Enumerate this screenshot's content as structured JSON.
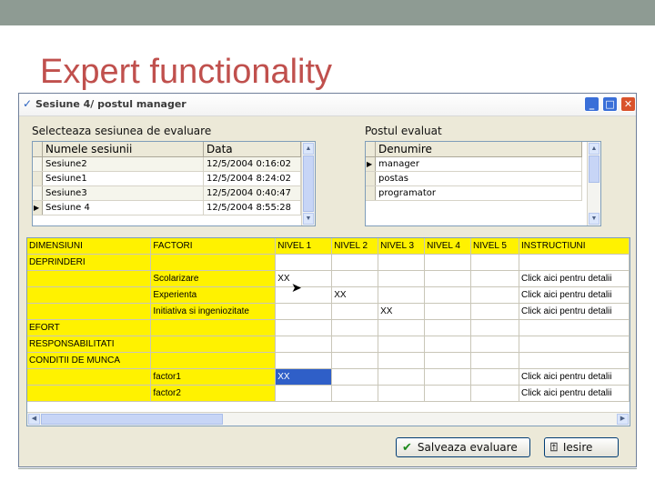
{
  "slide": {
    "title": "Expert functionality"
  },
  "window": {
    "title": "Sesiune 4/ postul manager",
    "min_glyph": "_",
    "max_glyph": "□",
    "close_glyph": "✕"
  },
  "sessions": {
    "label": "Selecteaza sesiunea de evaluare",
    "headers": [
      "Numele sesiunii",
      "Data"
    ],
    "rows": [
      {
        "marker": "",
        "name": "Sesiune2",
        "date": "12/5/2004 0:16:02"
      },
      {
        "marker": "",
        "name": "Sesiune1",
        "date": "12/5/2004 8:24:02"
      },
      {
        "marker": "",
        "name": "Sesiune3",
        "date": "12/5/2004 0:40:47"
      },
      {
        "marker": "▶",
        "name": "Sesiune 4",
        "date": "12/5/2004 8:55:28"
      }
    ]
  },
  "post": {
    "label": "Postul evaluat",
    "header": "Denumire",
    "rows": [
      {
        "marker": "▶",
        "name": "manager"
      },
      {
        "marker": "",
        "name": "postas"
      },
      {
        "marker": "",
        "name": "programator"
      }
    ]
  },
  "evaluation": {
    "headers": [
      "DIMENSIUNI",
      "FACTORI",
      "NIVEL 1",
      "NIVEL 2",
      "NIVEL 3",
      "NIVEL 4",
      "NIVEL 5",
      "INSTRUCTIUNI"
    ],
    "rows": [
      [
        "DEPRINDERI",
        "",
        "",
        "",
        "",
        "",
        "",
        ""
      ],
      [
        "",
        "Scolarizare",
        "XX",
        "",
        "",
        "",
        "",
        "Click aici pentru detalii"
      ],
      [
        "",
        "Experienta",
        "",
        "XX",
        "",
        "",
        "",
        "Click aici pentru detalii"
      ],
      [
        "",
        "Initiativa si ingeniozitate",
        "",
        "",
        "XX",
        "",
        "",
        "Click aici pentru detalii"
      ],
      [
        "EFORT",
        "",
        "",
        "",
        "",
        "",
        "",
        ""
      ],
      [
        "RESPONSABILITATI",
        "",
        "",
        "",
        "",
        "",
        "",
        ""
      ],
      [
        "CONDITII DE MUNCA",
        "",
        "",
        "",
        "",
        "",
        "",
        ""
      ],
      [
        "",
        "factor1",
        "XX",
        "",
        "",
        "",
        "",
        "Click aici pentru detalii"
      ],
      [
        "",
        "factor2",
        "",
        "",
        "",
        "",
        "",
        "Click aici pentru detalii"
      ]
    ],
    "selected": {
      "row": 7,
      "col": 2
    }
  },
  "buttons": {
    "save": "Salveaza evaluare",
    "exit": "Iesire"
  },
  "colors": {
    "title": "#c0504d",
    "yellow": "#fff200",
    "selection": "#2f5fc8"
  }
}
